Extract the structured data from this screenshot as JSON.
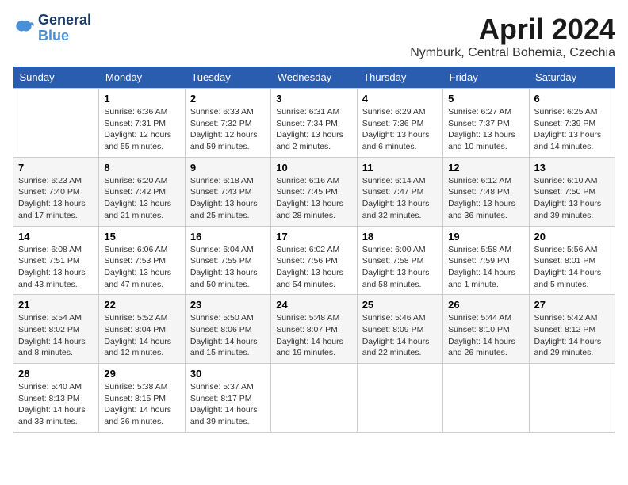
{
  "header": {
    "logo": {
      "line1": "General",
      "line2": "Blue"
    },
    "month": "April 2024",
    "location": "Nymburk, Central Bohemia, Czechia"
  },
  "weekdays": [
    "Sunday",
    "Monday",
    "Tuesday",
    "Wednesday",
    "Thursday",
    "Friday",
    "Saturday"
  ],
  "weeks": [
    [
      {
        "day": "",
        "detail": ""
      },
      {
        "day": "1",
        "detail": "Sunrise: 6:36 AM\nSunset: 7:31 PM\nDaylight: 12 hours\nand 55 minutes."
      },
      {
        "day": "2",
        "detail": "Sunrise: 6:33 AM\nSunset: 7:32 PM\nDaylight: 12 hours\nand 59 minutes."
      },
      {
        "day": "3",
        "detail": "Sunrise: 6:31 AM\nSunset: 7:34 PM\nDaylight: 13 hours\nand 2 minutes."
      },
      {
        "day": "4",
        "detail": "Sunrise: 6:29 AM\nSunset: 7:36 PM\nDaylight: 13 hours\nand 6 minutes."
      },
      {
        "day": "5",
        "detail": "Sunrise: 6:27 AM\nSunset: 7:37 PM\nDaylight: 13 hours\nand 10 minutes."
      },
      {
        "day": "6",
        "detail": "Sunrise: 6:25 AM\nSunset: 7:39 PM\nDaylight: 13 hours\nand 14 minutes."
      }
    ],
    [
      {
        "day": "7",
        "detail": "Sunrise: 6:23 AM\nSunset: 7:40 PM\nDaylight: 13 hours\nand 17 minutes."
      },
      {
        "day": "8",
        "detail": "Sunrise: 6:20 AM\nSunset: 7:42 PM\nDaylight: 13 hours\nand 21 minutes."
      },
      {
        "day": "9",
        "detail": "Sunrise: 6:18 AM\nSunset: 7:43 PM\nDaylight: 13 hours\nand 25 minutes."
      },
      {
        "day": "10",
        "detail": "Sunrise: 6:16 AM\nSunset: 7:45 PM\nDaylight: 13 hours\nand 28 minutes."
      },
      {
        "day": "11",
        "detail": "Sunrise: 6:14 AM\nSunset: 7:47 PM\nDaylight: 13 hours\nand 32 minutes."
      },
      {
        "day": "12",
        "detail": "Sunrise: 6:12 AM\nSunset: 7:48 PM\nDaylight: 13 hours\nand 36 minutes."
      },
      {
        "day": "13",
        "detail": "Sunrise: 6:10 AM\nSunset: 7:50 PM\nDaylight: 13 hours\nand 39 minutes."
      }
    ],
    [
      {
        "day": "14",
        "detail": "Sunrise: 6:08 AM\nSunset: 7:51 PM\nDaylight: 13 hours\nand 43 minutes."
      },
      {
        "day": "15",
        "detail": "Sunrise: 6:06 AM\nSunset: 7:53 PM\nDaylight: 13 hours\nand 47 minutes."
      },
      {
        "day": "16",
        "detail": "Sunrise: 6:04 AM\nSunset: 7:55 PM\nDaylight: 13 hours\nand 50 minutes."
      },
      {
        "day": "17",
        "detail": "Sunrise: 6:02 AM\nSunset: 7:56 PM\nDaylight: 13 hours\nand 54 minutes."
      },
      {
        "day": "18",
        "detail": "Sunrise: 6:00 AM\nSunset: 7:58 PM\nDaylight: 13 hours\nand 58 minutes."
      },
      {
        "day": "19",
        "detail": "Sunrise: 5:58 AM\nSunset: 7:59 PM\nDaylight: 14 hours\nand 1 minute."
      },
      {
        "day": "20",
        "detail": "Sunrise: 5:56 AM\nSunset: 8:01 PM\nDaylight: 14 hours\nand 5 minutes."
      }
    ],
    [
      {
        "day": "21",
        "detail": "Sunrise: 5:54 AM\nSunset: 8:02 PM\nDaylight: 14 hours\nand 8 minutes."
      },
      {
        "day": "22",
        "detail": "Sunrise: 5:52 AM\nSunset: 8:04 PM\nDaylight: 14 hours\nand 12 minutes."
      },
      {
        "day": "23",
        "detail": "Sunrise: 5:50 AM\nSunset: 8:06 PM\nDaylight: 14 hours\nand 15 minutes."
      },
      {
        "day": "24",
        "detail": "Sunrise: 5:48 AM\nSunset: 8:07 PM\nDaylight: 14 hours\nand 19 minutes."
      },
      {
        "day": "25",
        "detail": "Sunrise: 5:46 AM\nSunset: 8:09 PM\nDaylight: 14 hours\nand 22 minutes."
      },
      {
        "day": "26",
        "detail": "Sunrise: 5:44 AM\nSunset: 8:10 PM\nDaylight: 14 hours\nand 26 minutes."
      },
      {
        "day": "27",
        "detail": "Sunrise: 5:42 AM\nSunset: 8:12 PM\nDaylight: 14 hours\nand 29 minutes."
      }
    ],
    [
      {
        "day": "28",
        "detail": "Sunrise: 5:40 AM\nSunset: 8:13 PM\nDaylight: 14 hours\nand 33 minutes."
      },
      {
        "day": "29",
        "detail": "Sunrise: 5:38 AM\nSunset: 8:15 PM\nDaylight: 14 hours\nand 36 minutes."
      },
      {
        "day": "30",
        "detail": "Sunrise: 5:37 AM\nSunset: 8:17 PM\nDaylight: 14 hours\nand 39 minutes."
      },
      {
        "day": "",
        "detail": ""
      },
      {
        "day": "",
        "detail": ""
      },
      {
        "day": "",
        "detail": ""
      },
      {
        "day": "",
        "detail": ""
      }
    ]
  ]
}
